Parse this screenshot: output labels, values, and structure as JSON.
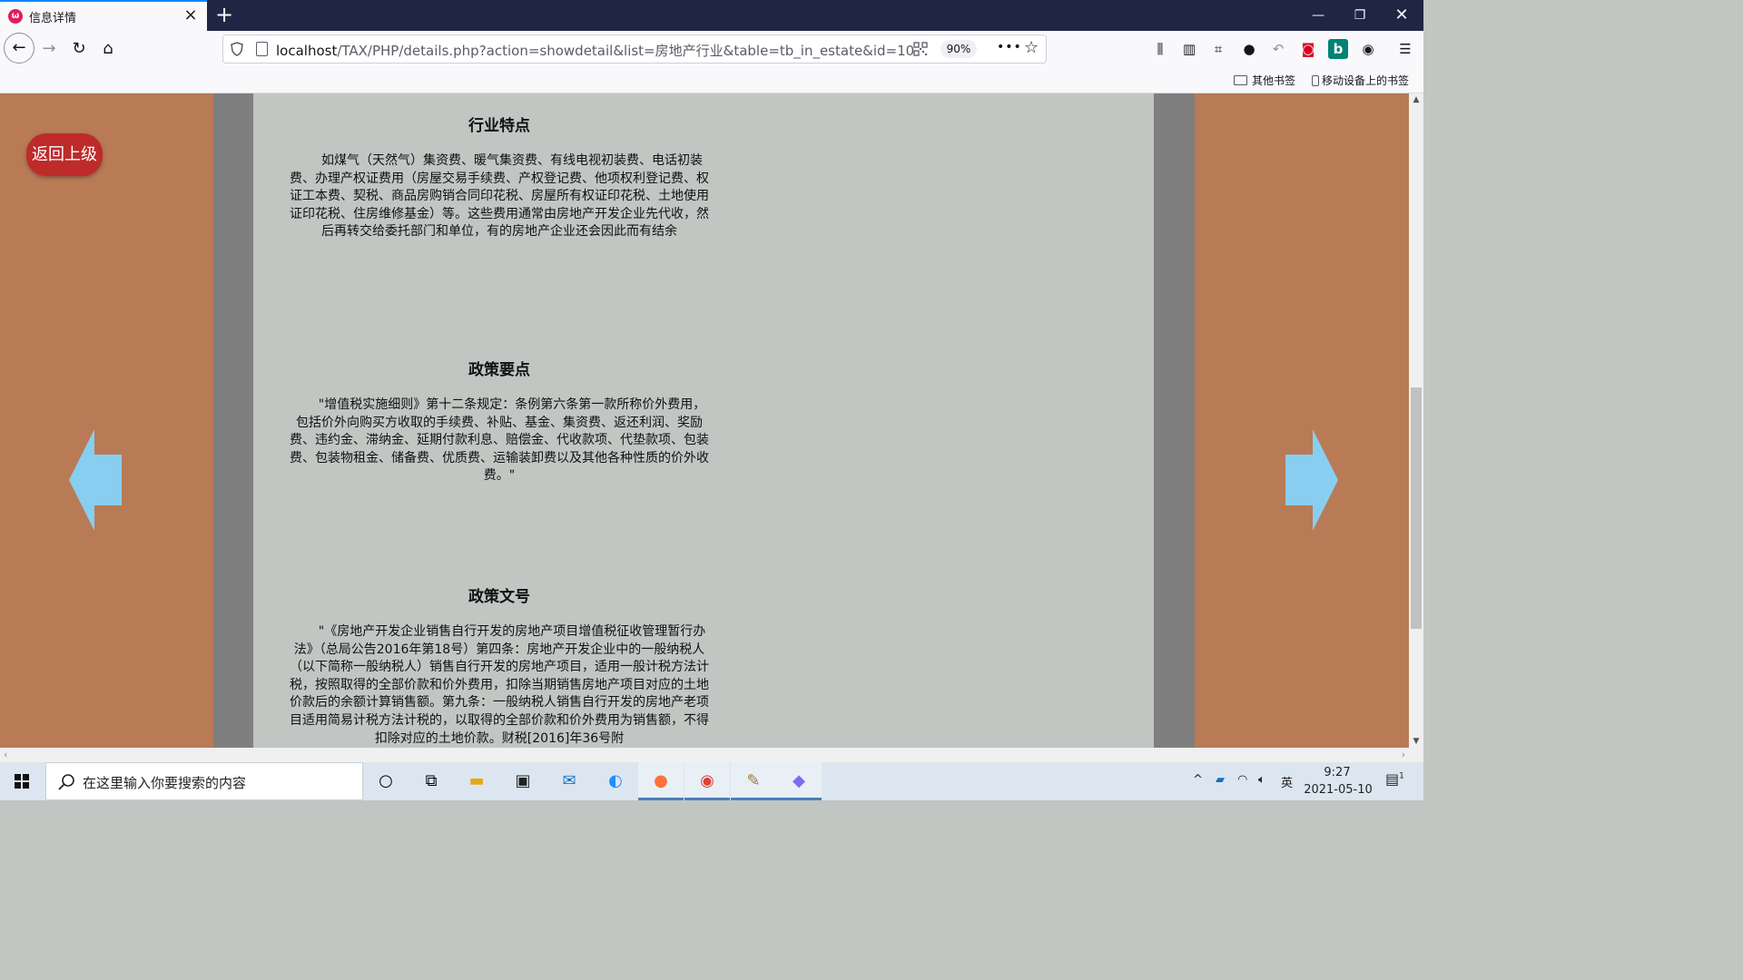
{
  "browser": {
    "tab_title": "信息详情",
    "url_host": "localhost",
    "url_path": "/TAX/PHP/details.php?action=showdetail&list=房地产行业&table=tb_in_estate&id=10",
    "zoom": "90%",
    "bookmarks": [
      "其他书签",
      "移动设备上的书签"
    ]
  },
  "page": {
    "back_button": "返回上级",
    "sections": [
      {
        "title": "行业特点",
        "text": "如煤气（天然气）集资费、暖气集资费、有线电视初装费、电话初装费、办理产权证费用（房屋交易手续费、产权登记费、他项权利登记费、权证工本费、契税、商品房购销合同印花税、房屋所有权证印花税、土地使用证印花税、住房维修基金）等。这些费用通常由房地产开发企业先代收，然后再转交给委托部门和单位，有的房地产企业还会因此而有结余"
      },
      {
        "title": "政策要点",
        "text": "\"增值税实施细则》第十二条规定：条例第六条第一款所称价外费用，包括价外向购买方收取的手续费、补贴、基金、集资费、返还利润、奖励费、违约金、滞纳金、延期付款利息、赔偿金、代收款项、代垫款项、包装费、包装物租金、储备费、优质费、运输装卸费以及其他各种性质的价外收费。\""
      },
      {
        "title": "政策文号",
        "text": "\"《房地产开发企业销售自行开发的房地产项目增值税征收管理暂行办法》（总局公告2016年第18号）第四条：房地产开发企业中的一般纳税人（以下简称一般纳税人）销售自行开发的房地产项目，适用一般计税方法计税，按照取得的全部价款和价外费用，扣除当期销售房地产项目对应的土地价款后的余额计算销售额。第九条：一般纳税人销售自行开发的房地产老项目适用简易计税方法计税的，以取得的全部价款和价外费用为销售额，不得扣除对应的土地价款。财税[2016]年36号附"
      }
    ]
  },
  "colors": {
    "side": "#b97a56",
    "gutter": "#7f7f7f",
    "content": "#c1c6c3",
    "back_button": "#bf2a2a",
    "arrow": "#87cef0"
  },
  "taskbar": {
    "search_placeholder": "在这里输入你要搜索的内容",
    "ime": "英",
    "time": "9:27",
    "date": "2021-05-10",
    "notifications": "1",
    "apps": [
      "cortana-icon",
      "task-view-icon",
      "file-explorer-icon",
      "store-icon",
      "mail-icon",
      "edge-icon",
      "firefox-icon",
      "chrome-icon",
      "paint-icon",
      "photos-icon"
    ]
  }
}
